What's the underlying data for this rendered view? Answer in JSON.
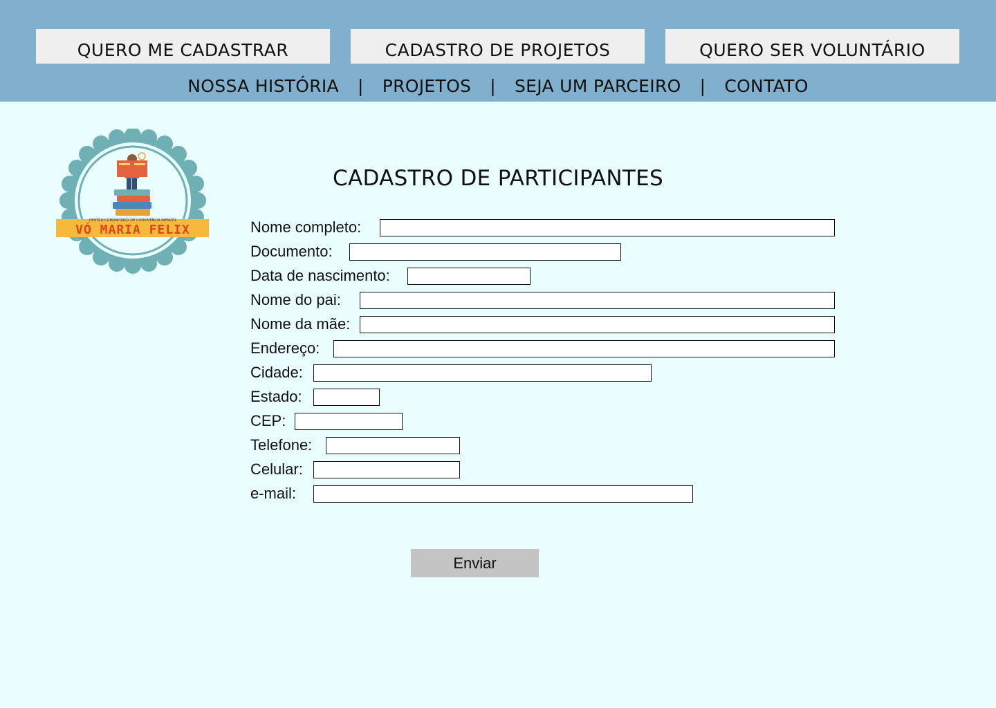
{
  "header": {
    "top_buttons": [
      "QUERO ME CADASTRAR",
      "CADASTRO DE PROJETOS",
      "QUERO SER VOLUNTÁRIO"
    ],
    "nav": [
      "NOSSA HISTÓRIA",
      "PROJETOS",
      "SEJA UM PARCEIRO",
      "CONTATO"
    ],
    "nav_separator": "|"
  },
  "logo": {
    "subtitle": "CENTRO COMUNITÁRIO DE CONVIVÊNCIA INFANTIL",
    "name": "VÓ MARIA FELIX"
  },
  "form": {
    "title": "CADASTRO DE PARTICIPANTES",
    "fields": [
      {
        "label": "Nome completo:",
        "value": ""
      },
      {
        "label": "Documento:",
        "value": ""
      },
      {
        "label": "Data de nascimento:",
        "value": ""
      },
      {
        "label": "Nome do pai:",
        "value": ""
      },
      {
        "label": "Nome da mãe:",
        "value": ""
      },
      {
        "label": "Endereço:",
        "value": ""
      },
      {
        "label": "Cidade:",
        "value": ""
      },
      {
        "label": "Estado:",
        "value": ""
      },
      {
        "label": "CEP:",
        "value": ""
      },
      {
        "label": "Telefone:",
        "value": ""
      },
      {
        "label": "Celular:",
        "value": ""
      },
      {
        "label": "e-mail:",
        "value": ""
      }
    ],
    "submit_label": "Enviar"
  },
  "colors": {
    "header_bg": "#80b0cd",
    "page_bg": "#ebfeff",
    "button_bg": "#efeff0",
    "submit_bg": "#c4c4c4",
    "logo_ring": "#6fb0b5",
    "logo_banner": "#f6b93b",
    "logo_text": "#d9481c"
  }
}
